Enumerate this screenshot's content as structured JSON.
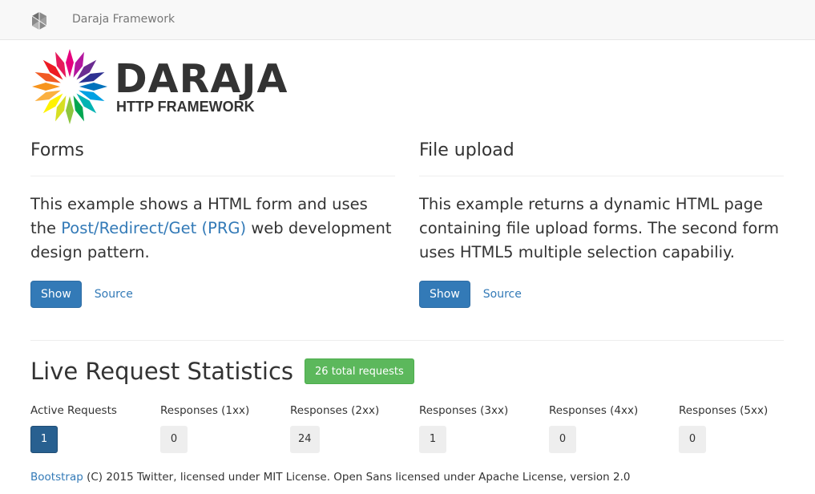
{
  "navbar": {
    "brand": "Daraja Framework"
  },
  "logo": {
    "word": "DARAJA",
    "subtitle": "HTTP FRAMEWORK"
  },
  "examples": [
    {
      "title": "Forms",
      "text_before": "This example shows a HTML form and uses the ",
      "link": "Post/Redirect/Get (PRG)",
      "text_after": " web development design pattern.",
      "show_label": "Show",
      "source_label": "Source"
    },
    {
      "title": "File upload",
      "text": "This example returns a dynamic HTML page containing file upload forms. The second form uses HTML5 multiple selection capabiliy.",
      "show_label": "Show",
      "source_label": "Source"
    }
  ],
  "stats": {
    "title": "Live Request Statistics",
    "total_label": "26 total requests",
    "items": [
      {
        "label": "Active Requests",
        "value": "1"
      },
      {
        "label": "Responses (1xx)",
        "value": "0"
      },
      {
        "label": "Responses (2xx)",
        "value": "24"
      },
      {
        "label": "Responses (3xx)",
        "value": "1"
      },
      {
        "label": "Responses (4xx)",
        "value": "0"
      },
      {
        "label": "Responses (5xx)",
        "value": "0"
      }
    ]
  },
  "footer": {
    "link": "Bootstrap",
    "text": " (C) 2015 Twitter, licensed under MIT License. Open Sans licensed under Apache License, version 2.0"
  },
  "colors": {
    "primary": "#337ab7",
    "success": "#5cb85c",
    "active_badge": "#286090",
    "badge": "#eeeeee"
  }
}
